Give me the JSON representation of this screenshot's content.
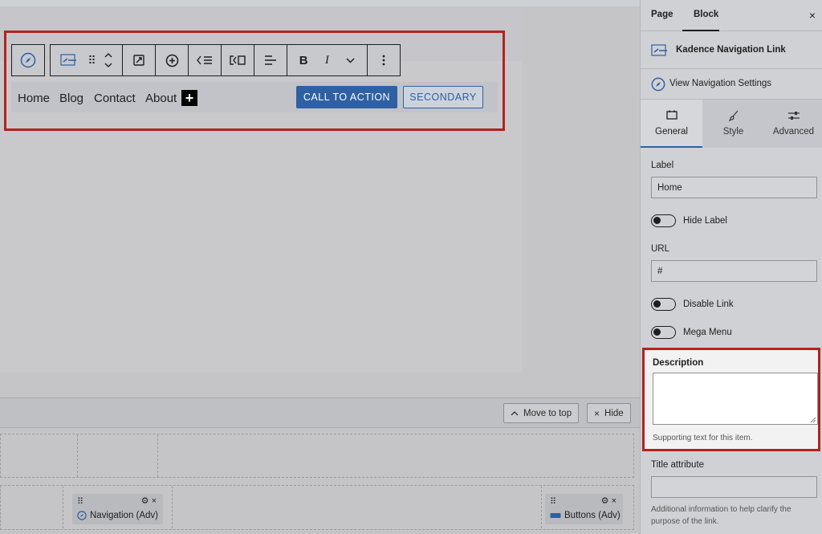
{
  "toolbar": {
    "buttons": [
      "navigation-icon",
      "nav-link-block-icon",
      "drag-handle-icon",
      "move-up-down-icon",
      "link-icon",
      "add-submenu-icon",
      "indent-icon",
      "outdent-icon",
      "align-icon",
      "bold-icon",
      "italic-icon",
      "more-rich-text-icon",
      "more-options-icon"
    ],
    "bold_label": "B",
    "italic_label": "I"
  },
  "nav_preview": {
    "links": [
      "Home",
      "Blog",
      "Contact",
      "About"
    ],
    "add_label": "+",
    "cta_label": "CALL TO ACTION",
    "secondary_label": "SECONDARY",
    "accent_color": "#2e60a4"
  },
  "builder": {
    "move_to_top_label": "Move to top",
    "hide_label": "Hide",
    "nav_item_label": "Navigation (Adv)",
    "buttons_item_label": "Buttons (Adv)"
  },
  "sidebar": {
    "tabs": {
      "page": "Page",
      "block": "Block"
    },
    "close_label": "×",
    "block_name": "Kadence Navigation Link",
    "nav_settings_label": "View Navigation Settings",
    "subtabs": {
      "general": "General",
      "style": "Style",
      "advanced": "Advanced"
    },
    "label_field": {
      "label": "Label",
      "value": "Home"
    },
    "hide_label_toggle": "Hide Label",
    "url_field": {
      "label": "URL",
      "value": "#"
    },
    "disable_link_toggle": "Disable Link",
    "mega_menu_toggle": "Mega Menu",
    "description": {
      "label": "Description",
      "value": "",
      "help": "Supporting text for this item."
    },
    "title_attribute": {
      "label": "Title attribute",
      "value": "",
      "help": "Additional information to help clarify the purpose of the link."
    },
    "highlight_color": "#b2231d"
  }
}
